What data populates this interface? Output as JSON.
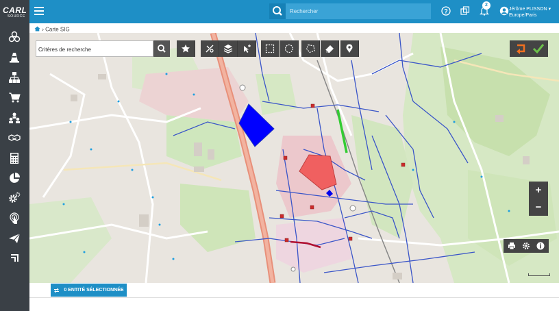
{
  "app": {
    "logo_text": "CARL",
    "logo_sub": "SOURCE"
  },
  "header": {
    "search_placeholder": "Rechercher",
    "notifications_count": "2",
    "user_name": "Jérôme PLISSON",
    "user_timezone": "Europe/Paris"
  },
  "breadcrumb": {
    "separator": "›",
    "current": "Carte SIG"
  },
  "map": {
    "criteria_placeholder": "Critères de recherche",
    "scale_label": "",
    "colors": {
      "blue_polygon": "#0000ff",
      "red_polygon": "#f06060",
      "green_line": "#33cc33",
      "brand": "#1e8fc6"
    }
  },
  "sidebar": {
    "items": [
      {
        "icon": "components-icon"
      },
      {
        "icon": "cone-icon"
      },
      {
        "icon": "hierarchy-icon"
      },
      {
        "icon": "cart-icon"
      },
      {
        "icon": "team-icon"
      },
      {
        "icon": "handshake-icon"
      },
      {
        "icon": "calculator-icon"
      },
      {
        "icon": "pie-chart-icon"
      },
      {
        "icon": "settings-icon"
      },
      {
        "icon": "touch-icon"
      },
      {
        "icon": "send-icon"
      },
      {
        "icon": "exit-icon"
      }
    ]
  },
  "footer": {
    "selection_label": "0 ENTITÉ SÉLECTIONNÉE"
  }
}
